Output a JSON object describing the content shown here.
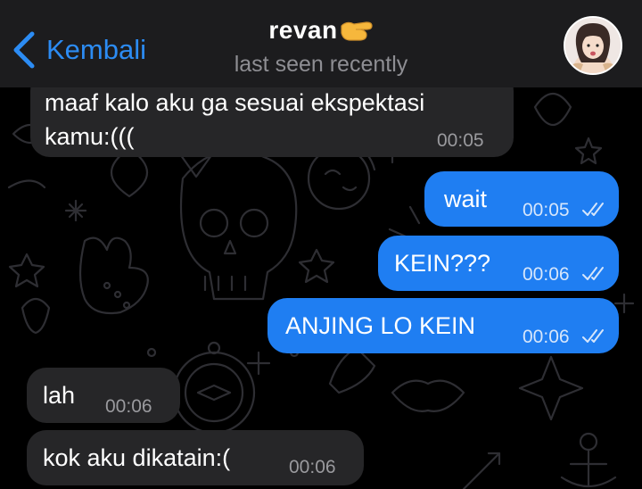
{
  "header": {
    "back_label": "Kembali",
    "contact_name": "revan",
    "status": "last seen recently"
  },
  "messages": [
    {
      "direction": "incoming",
      "text_line1": "maaf kalo aku ga sesuai ekspektasi",
      "text_line2": "kamu:(((",
      "time": "00:05"
    },
    {
      "direction": "outgoing",
      "text": "wait",
      "time": "00:05",
      "status": "read"
    },
    {
      "direction": "outgoing",
      "text": "KEIN???",
      "time": "00:06",
      "status": "read"
    },
    {
      "direction": "outgoing",
      "text": "ANJING LO KEIN",
      "time": "00:06",
      "status": "read"
    },
    {
      "direction": "incoming",
      "text": "lah",
      "time": "00:06"
    },
    {
      "direction": "incoming",
      "text": "kok aku dikatain:(",
      "time": "00:06"
    }
  ],
  "icons": {
    "back": "chevron-left-icon",
    "name_emoji": "pinching-hand-icon",
    "read_receipt": "double-check-icon",
    "avatar": "avatar"
  },
  "colors": {
    "accent": "#2c8cf4",
    "outgoing_bubble": "#1f7ef2",
    "incoming_bubble": "#262628",
    "header": "#1c1c1e",
    "background": "#000000"
  }
}
